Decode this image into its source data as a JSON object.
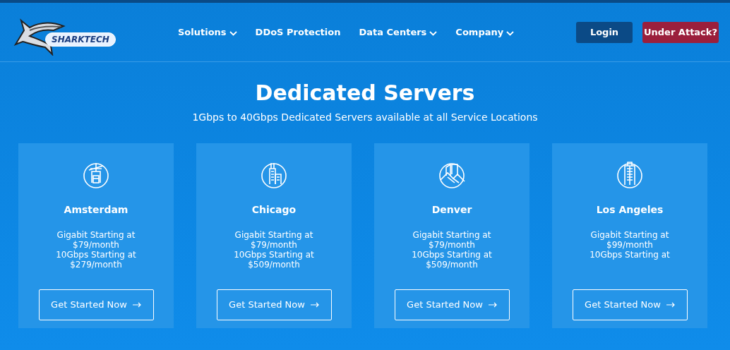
{
  "logo": {
    "text": "SHARKTECH"
  },
  "nav": [
    {
      "label": "Solutions",
      "has_menu": true
    },
    {
      "label": "DDoS Protection",
      "has_menu": false
    },
    {
      "label": "Data Centers",
      "has_menu": true
    },
    {
      "label": "Company",
      "has_menu": true
    }
  ],
  "header_buttons": [
    {
      "label": "Login",
      "kind": "login"
    },
    {
      "label": "Under Attack?",
      "kind": "alert"
    }
  ],
  "hero": {
    "title": "Dedicated Servers",
    "subtitle": "1Gbps to 40Gbps Dedicated Servers available at all Service Locations"
  },
  "locations": [
    {
      "city": "Amsterdam",
      "lines": [
        "Gigabit Starting at",
        "$79/month",
        "10Gbps Starting at",
        "$279/month"
      ],
      "button": "Get Started Now"
    },
    {
      "city": "Chicago",
      "lines": [
        "Gigabit Starting at",
        "$79/month",
        "10Gbps Starting at",
        "$509/month"
      ],
      "button": "Get Started Now"
    },
    {
      "city": "Denver",
      "lines": [
        "Gigabit Starting at",
        "$79/month",
        "10Gbps Starting at",
        "$509/month"
      ],
      "button": "Get Started Now"
    },
    {
      "city": "Los Angeles",
      "lines": [
        "Gigabit Starting at",
        "$99/month",
        "10Gbps Starting at"
      ],
      "button": "Get Started Now"
    }
  ]
}
